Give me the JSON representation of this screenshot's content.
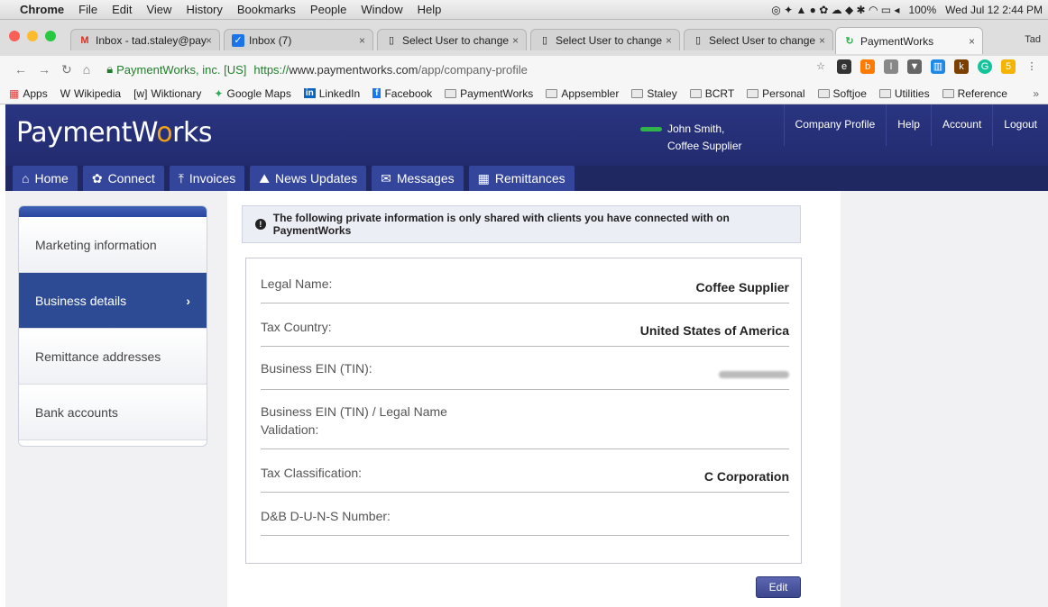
{
  "menubar": {
    "apple": "",
    "items": [
      "Chrome",
      "File",
      "Edit",
      "View",
      "History",
      "Bookmarks",
      "People",
      "Window",
      "Help"
    ],
    "battery": "100%",
    "clock": "Wed Jul 12 2:44 PM"
  },
  "tabs": [
    {
      "label": "Inbox - tad.staley@pay",
      "icon": "gmail-icon",
      "active": false
    },
    {
      "label": "Inbox (7)",
      "icon": "inbox-icon",
      "active": false
    },
    {
      "label": "Select User to change",
      "icon": "page-icon",
      "active": false
    },
    {
      "label": "Select User to change",
      "icon": "page-icon",
      "active": false
    },
    {
      "label": "Select User to change",
      "icon": "page-icon",
      "active": false
    },
    {
      "label": "PaymentWorks",
      "icon": "paymentworks-icon",
      "active": true
    }
  ],
  "profile_name": "Tad",
  "address": {
    "site": "PaymentWorks, inc. [US]",
    "url_prefix": "https://",
    "url_host": "www.paymentworks.com",
    "url_path": "/app/company-profile"
  },
  "bookmarks": [
    "Apps",
    "Wikipedia",
    "Wiktionary",
    "Google Maps",
    "LinkedIn",
    "Facebook",
    "PaymentWorks",
    "Appsembler",
    "Staley",
    "BCRT",
    "Personal",
    "Softjoe",
    "Utilities",
    "Reference"
  ],
  "bookmark_prefixes": {
    "wikipedia": "W",
    "wiktionary": "[w]",
    "linkedin": "in",
    "facebook": "f"
  },
  "header": {
    "logo_pre": "PaymentW",
    "logo_mid": "o",
    "logo_post": "rks",
    "user_name": "John Smith,",
    "user_company": "Coffee Supplier",
    "links": [
      "Company Profile",
      "Help",
      "Account",
      "Logout"
    ]
  },
  "nav": [
    {
      "label": "Home",
      "icon": "home-icon",
      "glyph": "⌂"
    },
    {
      "label": "Connect",
      "icon": "gear-icon",
      "glyph": "✿"
    },
    {
      "label": "Invoices",
      "icon": "upload-icon",
      "glyph": "⤒"
    },
    {
      "label": "News Updates",
      "icon": "news-icon",
      "glyph": "⛰"
    },
    {
      "label": "Messages",
      "icon": "mail-icon",
      "glyph": "✉"
    },
    {
      "label": "Remittances",
      "icon": "bank-icon",
      "glyph": "▦"
    }
  ],
  "sidebar": {
    "items": [
      {
        "label": "Marketing information",
        "active": false
      },
      {
        "label": "Business details",
        "active": true
      },
      {
        "label": "Remittance addresses",
        "active": false
      },
      {
        "label": "Bank accounts",
        "active": false
      }
    ]
  },
  "notice": "The following private information is only shared with clients you have connected with on PaymentWorks",
  "fields": [
    {
      "label": "Legal Name:",
      "value": "Coffee Supplier"
    },
    {
      "label": "Tax Country:",
      "value": "United States of America"
    },
    {
      "label": "Business EIN (TIN):",
      "value": ""
    },
    {
      "label": "Business EIN (TIN) / Legal Name Validation:",
      "value": ""
    },
    {
      "label": "Tax Classification:",
      "value": "C Corporation"
    },
    {
      "label": "D&B D-U-N-S Number:",
      "value": ""
    }
  ],
  "edit_label": "Edit",
  "colors": {
    "header_bg": "#28337c",
    "nav_bg": "#1f2860",
    "nav_tab": "#34469b",
    "sidebar_active": "#2c4b94",
    "logo_accent": "#f0a21a"
  }
}
